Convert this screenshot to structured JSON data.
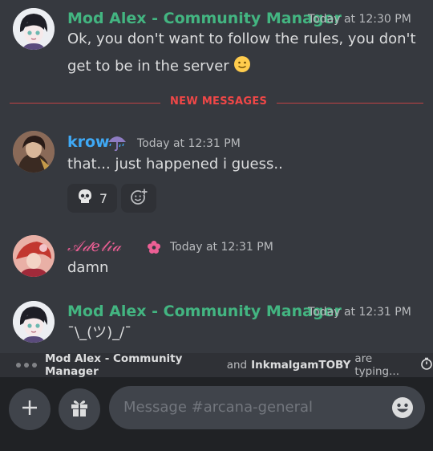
{
  "colors": {
    "mod_name": "#43b581",
    "krow_name": "#3fa9f5",
    "adelia_name": "#ed5f95",
    "new_divider": "#f04747"
  },
  "messages": [
    {
      "author": "Mod Alex - Community Manager",
      "time": "Today at 12:30 PM",
      "lines": [
        "Ok, you don't want to follow the rules, you don't",
        "get to be in the server"
      ],
      "emoji": "🙂"
    },
    {
      "author": "krow",
      "badge_icon": "umbrella-rain-icon",
      "time": "Today at 12:31 PM",
      "text": "that... just happened i guess..",
      "reaction": {
        "emoji_icon": "skull-icon",
        "count": "7"
      }
    },
    {
      "author": "𝒜𝒹𝑒𝓁𝒾𝒶",
      "badge_icon": "flower-icon",
      "time": "Today at 12:31 PM",
      "text": "damn"
    },
    {
      "author": "Mod Alex - Community Manager",
      "time": "Today at 12:31 PM",
      "text": "¯\\_(ツ)_/¯"
    }
  ],
  "divider": {
    "label": "NEW MESSAGES"
  },
  "typing": {
    "user1": "Mod Alex - Community Manager",
    "conj": "and",
    "user2": "InkmalgamTOBY",
    "suffix": "are typing..."
  },
  "composer": {
    "placeholder": "Message #arcana-general"
  }
}
